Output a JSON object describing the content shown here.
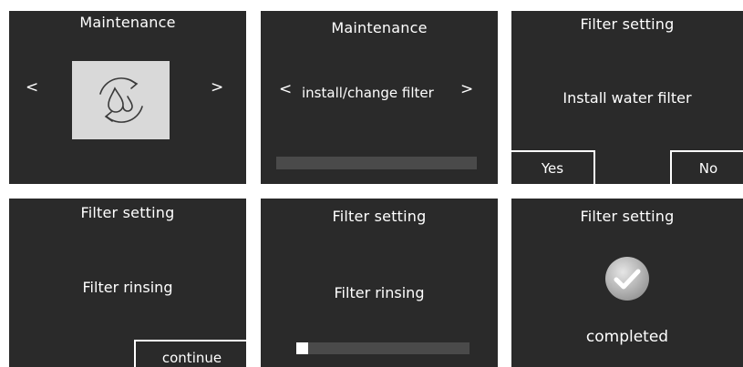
{
  "colors": {
    "panel_bg": "#2a2a2a",
    "text": "#ffffff",
    "tile_bg": "#d9d9d9",
    "progress_track": "#4a4a4a",
    "progress_fill": "#ffffff",
    "check_badge": "#bdbdbd"
  },
  "screens": [
    {
      "title": "Maintenance",
      "prev_glyph": "<",
      "next_glyph": ">",
      "tile_icon": "filter-cycle-icon"
    },
    {
      "title": "Maintenance",
      "prev_glyph": "<",
      "option_label": "install/change filter",
      "next_glyph": ">",
      "progress": 0.0
    },
    {
      "title": "Filter setting",
      "message": "Install water filter",
      "yes_label": "Yes",
      "no_label": "No"
    },
    {
      "title": "Filter setting",
      "message": "Filter rinsing",
      "continue_label": "continue"
    },
    {
      "title": "Filter setting",
      "message": "Filter rinsing",
      "progress": 0.07
    },
    {
      "title": "Filter setting",
      "status_icon": "checkmark-icon",
      "status_label": "completed"
    }
  ]
}
